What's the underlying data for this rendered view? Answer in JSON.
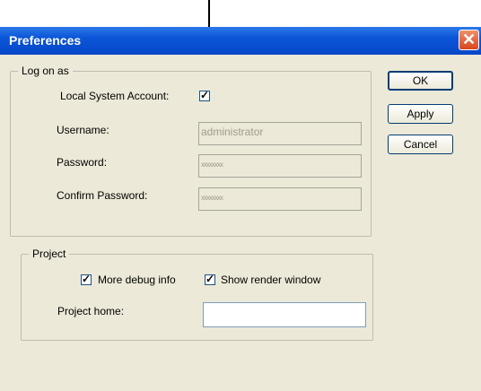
{
  "window": {
    "title": "Preferences",
    "close_glyph": "✕"
  },
  "logon_group": {
    "legend": "Log on as",
    "local_system_label": "Local System Account:",
    "local_system_checked": true,
    "username_label": "Username:",
    "username_value": "administrator",
    "password_label": "Password:",
    "password_value": "xxxxxxxx",
    "confirm_label": "Confirm Password:",
    "confirm_value": "xxxxxxxx"
  },
  "project_group": {
    "legend": "Project",
    "debug_label": "More debug info",
    "debug_checked": true,
    "render_label": "Show render window",
    "render_checked": true,
    "home_label": "Project home:",
    "home_value": ""
  },
  "buttons": {
    "ok": "OK",
    "apply": "Apply",
    "cancel": "Cancel"
  },
  "check_glyph": "✓",
  "icons": {
    "close": "close-icon",
    "arrow": "down-arrow-icon",
    "checkmark": "checkmark-icon"
  }
}
